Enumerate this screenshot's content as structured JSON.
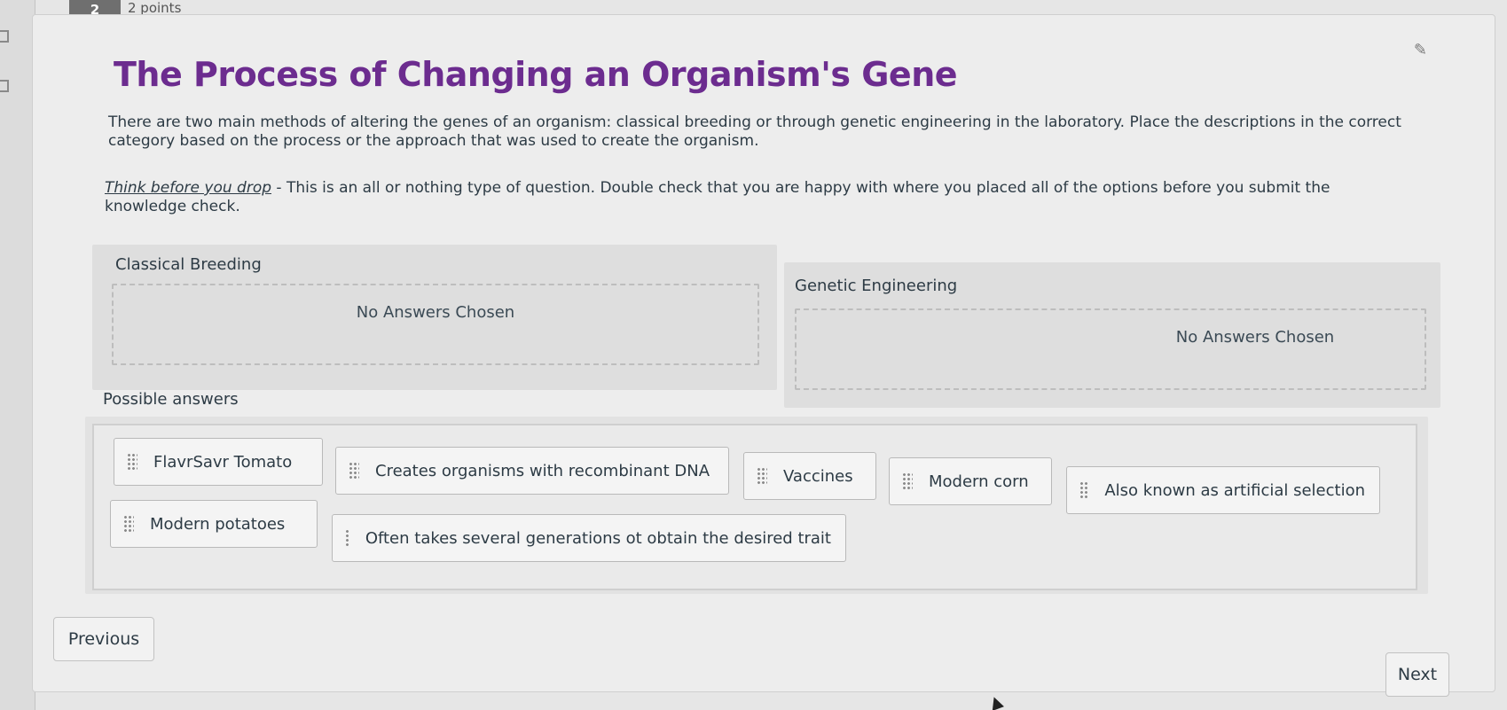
{
  "question": {
    "number": "2",
    "points": "2 points",
    "title": "The Process of Changing an Organism's Gene",
    "intro": "There are two main methods of altering the genes of an organism: classical breeding or through genetic engineering in the laboratory. Place the descriptions in the correct category based on the process or the approach that was used to create the organism.",
    "warning_emphasis": "Think before you drop",
    "warning_rest": " - This is an all or nothing type of question. Double check that you are happy with where you placed all of the options before you submit the knowledge check."
  },
  "categories": [
    {
      "label": "Classical Breeding",
      "empty_text": "No Answers Chosen"
    },
    {
      "label": "Genetic Engineering",
      "empty_text": "No Answers Chosen"
    }
  ],
  "possible_answers_label": "Possible answers",
  "answers": [
    "FlavrSavr Tomato",
    "Creates organisms with recombinant DNA",
    "Vaccines",
    "Modern corn",
    "Also known as artificial selection",
    "Modern potatoes",
    "Often takes several generations ot obtain the desired trait"
  ],
  "nav": {
    "previous": "Previous",
    "next": "Next"
  },
  "icons": {
    "pin": "pin-icon",
    "drag": "drag-handle-icon"
  },
  "colors": {
    "title": "#6c2c8f"
  }
}
